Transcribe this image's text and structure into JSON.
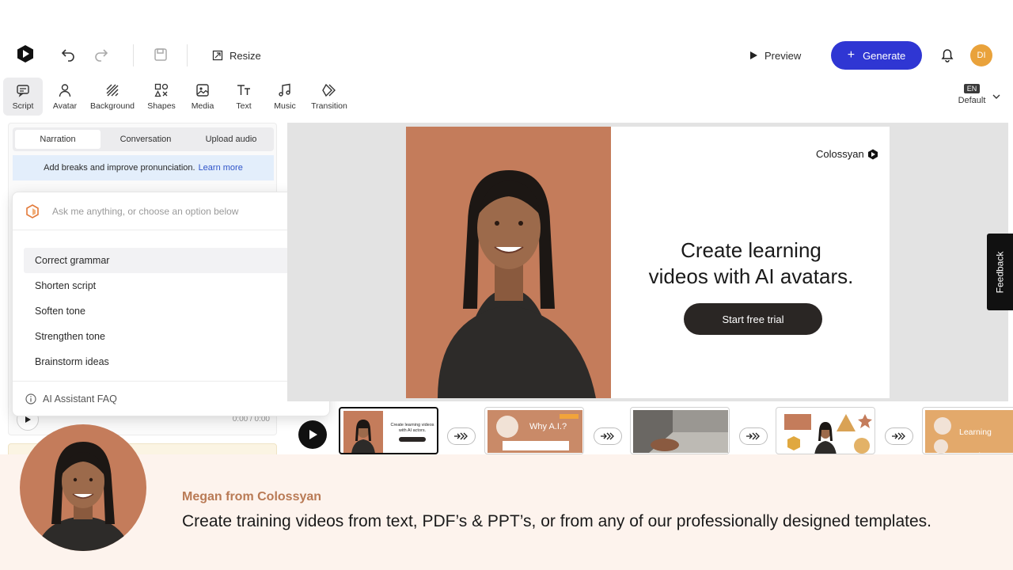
{
  "header": {
    "resize_label": "Resize",
    "preview_label": "Preview",
    "generate_label": "Generate",
    "user_initials": "DI"
  },
  "toolbar": {
    "items": [
      {
        "label": "Script",
        "icon": "script-icon"
      },
      {
        "label": "Avatar",
        "icon": "avatar-icon"
      },
      {
        "label": "Background",
        "icon": "background-icon"
      },
      {
        "label": "Shapes",
        "icon": "shapes-icon"
      },
      {
        "label": "Media",
        "icon": "media-icon"
      },
      {
        "label": "Text",
        "icon": "text-icon"
      },
      {
        "label": "Music",
        "icon": "music-icon"
      },
      {
        "label": "Transition",
        "icon": "transition-icon"
      }
    ],
    "language_code": "EN",
    "language_label": "Default"
  },
  "script_panel": {
    "tabs": [
      "Narration",
      "Conversation",
      "Upload audio"
    ],
    "tip_text": "Add breaks and improve pronunciation.",
    "tip_link": "Learn more",
    "timecode": "0:00 / 0:00"
  },
  "ai_assistant": {
    "placeholder": "Ask me anything, or choose an option below",
    "options": [
      "Correct grammar",
      "Shorten script",
      "Soften tone",
      "Strengthen tone",
      "Brainstorm ideas"
    ],
    "faq_label": "AI Assistant FAQ"
  },
  "slide": {
    "brand": "Colossyan",
    "headline_line1": "Create learning",
    "headline_line2": "videos with AI avatars.",
    "cta": "Start free trial"
  },
  "feedback_label": "Feedback",
  "timeline": {
    "thumbs": [
      {
        "title": "Create learning videos with AI actors."
      },
      {
        "title": "Why A.I.?"
      },
      {
        "title": ""
      },
      {
        "title": ""
      },
      {
        "title": "Learning Development"
      }
    ]
  },
  "caption": {
    "speaker": "Megan from Colossyan",
    "text": "Create training videos from text, PDF’s & PPT’s, or from any of our professionally designed templates."
  },
  "colors": {
    "accent": "#2f36d3",
    "avatar_bg": "#c47c5b",
    "user_avatar": "#e9a23b"
  }
}
